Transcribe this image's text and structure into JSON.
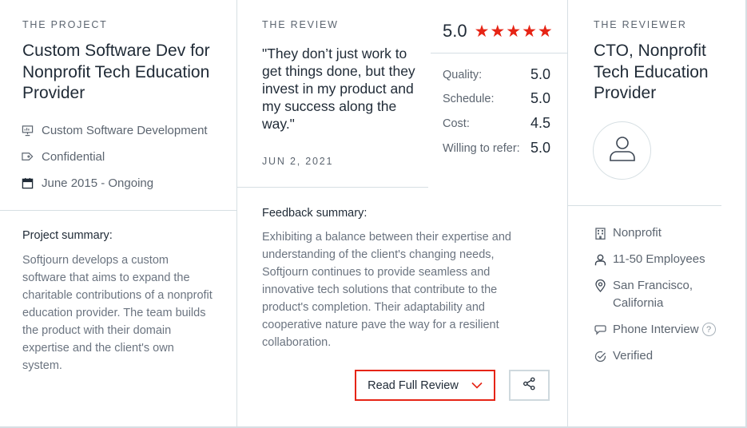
{
  "project": {
    "eyebrow": "THE PROJECT",
    "title": "Custom Software Dev for Nonprofit Tech Education Provider",
    "service": "Custom Software Development",
    "budget": "Confidential",
    "timeline": "June 2015 - Ongoing",
    "summary_label": "Project summary:",
    "summary_text": "Softjourn develops a custom software that aims to expand the charitable contributions of a nonprofit education provider. The team builds the product with their domain expertise and the client's own system."
  },
  "review": {
    "eyebrow": "THE REVIEW",
    "quote": "\"They don’t just work to get things done, but they invest in my product and my success along the way.\"",
    "date": "JUN 2, 2021",
    "overall_score": "5.0",
    "stars": 5,
    "ratings": [
      {
        "label": "Quality:",
        "value": "5.0"
      },
      {
        "label": "Schedule:",
        "value": "5.0"
      },
      {
        "label": "Cost:",
        "value": "4.5"
      },
      {
        "label": "Willing to refer:",
        "value": "5.0"
      }
    ],
    "feedback_label": "Feedback summary:",
    "feedback_text": "Exhibiting a balance between their expertise and understanding of the client's changing needs, Softjourn continues to provide seamless and innovative tech solutions that contribute to the product's completion. Their adaptability and cooperative nature pave the way for a resilient collaboration.",
    "read_full_label": "Read Full Review"
  },
  "reviewer": {
    "eyebrow": "THE REVIEWER",
    "title": "CTO, Nonprofit Tech Education Provider",
    "industry": "Nonprofit",
    "size": "11-50 Employees",
    "location": "San Francisco, California",
    "interview": "Phone Interview",
    "help_glyph": "?",
    "verified": "Verified"
  },
  "colors": {
    "accent_red": "#e62415",
    "divider": "#d6dfe3",
    "text_dark": "#1f2a36",
    "text_muted": "#6b7480"
  }
}
